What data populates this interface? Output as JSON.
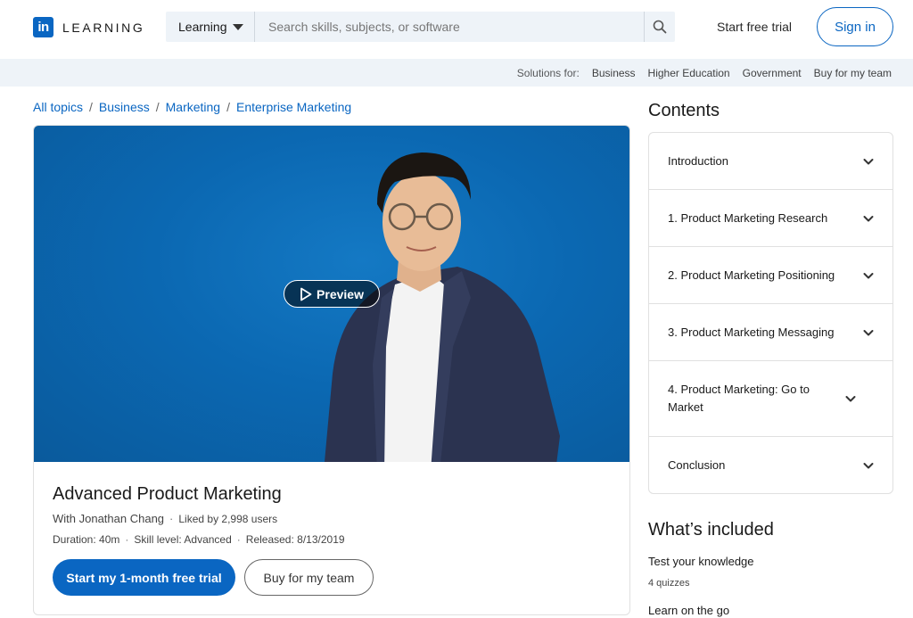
{
  "header": {
    "logo_mark": "in",
    "logo_text": "LEARNING",
    "search_scope": "Learning",
    "search_placeholder": "Search skills, subjects, or software",
    "start_trial": "Start free trial",
    "sign_in": "Sign in"
  },
  "subnav": {
    "label": "Solutions for:",
    "items": [
      "Business",
      "Higher Education",
      "Government",
      "Buy for my team"
    ]
  },
  "breadcrumb": [
    "All topics",
    "Business",
    "Marketing",
    "Enterprise Marketing"
  ],
  "course": {
    "preview_label": "Preview",
    "title": "Advanced Product Marketing",
    "instructor": "With Jonathan Chang",
    "likes": "Liked by 2,998 users",
    "duration": "Duration: 40m",
    "skill_level": "Skill level: Advanced",
    "released": "Released: 8/13/2019",
    "cta_primary": "Start my 1-month free trial",
    "cta_secondary": "Buy for my team"
  },
  "contents": {
    "title": "Contents",
    "items": [
      "Introduction",
      "1. Product Marketing Research",
      "2. Product Marketing Positioning",
      "3. Product Marketing Messaging",
      "4. Product Marketing: Go to Market",
      "Conclusion"
    ]
  },
  "included": {
    "title": "What’s included",
    "items": [
      {
        "heading": "Test your knowledge",
        "sub": "4 quizzes"
      },
      {
        "heading": "Learn on the go",
        "sub": ""
      }
    ]
  },
  "colors": {
    "brand": "#0a66c2",
    "subnav_bg": "#eef3f8",
    "hero_bg": "#0b68b2"
  }
}
